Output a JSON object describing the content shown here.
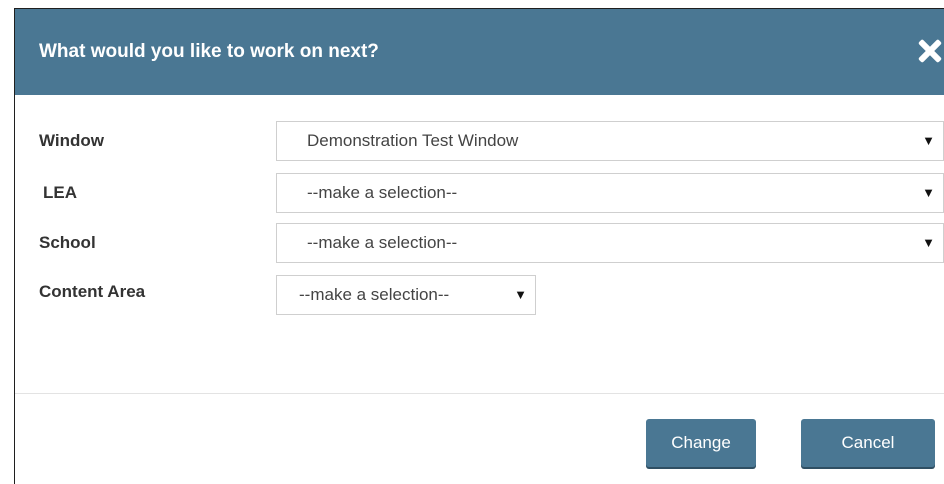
{
  "dialog": {
    "title": "What would you like to work on next?",
    "close_icon": "close-icon"
  },
  "fields": {
    "window": {
      "label": "Window",
      "value": "Demonstration Test Window"
    },
    "lea": {
      "label": "LEA",
      "value": "--make a selection--"
    },
    "school": {
      "label": "School",
      "value": "--make a selection--"
    },
    "content_area": {
      "label": "Content Area",
      "value": "--make a selection--"
    }
  },
  "arrow_glyph": "▼",
  "buttons": {
    "change": "Change",
    "cancel": "Cancel"
  },
  "colors": {
    "header": "#4a7793",
    "button": "#4a7793"
  }
}
